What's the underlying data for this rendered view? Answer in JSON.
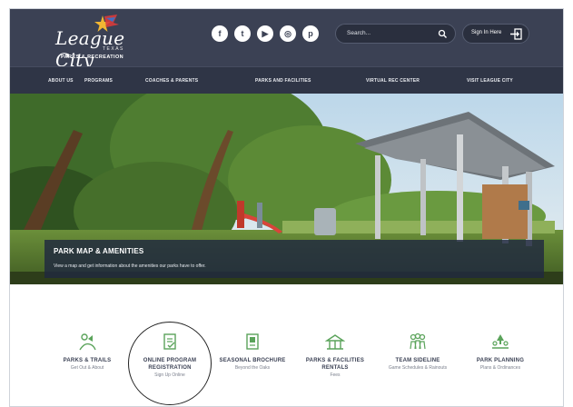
{
  "brand": {
    "logo_script": "League City",
    "logo_state": "TEXAS",
    "logo_sub": "PARKS & RECREATION"
  },
  "header": {
    "socials": [
      {
        "icon": "facebook-icon",
        "glyph": "f"
      },
      {
        "icon": "twitter-icon",
        "glyph": "t"
      },
      {
        "icon": "youtube-icon",
        "glyph": "▶"
      },
      {
        "icon": "instagram-icon",
        "glyph": "◎"
      },
      {
        "icon": "pinterest-icon",
        "glyph": "p"
      }
    ],
    "search_placeholder": "Search...",
    "signin_label": "Sign In Here"
  },
  "nav": {
    "items": [
      "ABOUT US",
      "PROGRAMS",
      "COACHES & PARENTS",
      "PARKS AND FACILITIES",
      "VIRTUAL REC CENTER",
      "VISIT LEAGUE CITY"
    ]
  },
  "hero": {
    "title": "PARK MAP & AMENITIES",
    "text": "View a map and get information about the amenities our parks have to offer."
  },
  "quick_links": [
    {
      "title": "PARKS & TRAILS",
      "sub": "Get Out & About",
      "icon": "trail-icon"
    },
    {
      "title": "ONLINE PROGRAM REGISTRATION",
      "sub": "Sign Up Online",
      "icon": "registration-icon"
    },
    {
      "title": "SEASONAL BROCHURE",
      "sub": "Beyond the Oaks",
      "icon": "brochure-icon"
    },
    {
      "title": "PARKS & FACILITIES RENTALS",
      "sub": "Fees",
      "icon": "pavilion-icon"
    },
    {
      "title": "TEAM SIDELINE",
      "sub": "Game Schedules & Rainouts",
      "icon": "team-icon"
    },
    {
      "title": "PARK PLANNING",
      "sub": "Plans & Ordinances",
      "icon": "planning-icon"
    }
  ],
  "colors": {
    "header_bg": "#3b4154",
    "nav_bg": "#2f3546",
    "accent_green": "#5aa35a",
    "overlay_bg": "#202840"
  }
}
